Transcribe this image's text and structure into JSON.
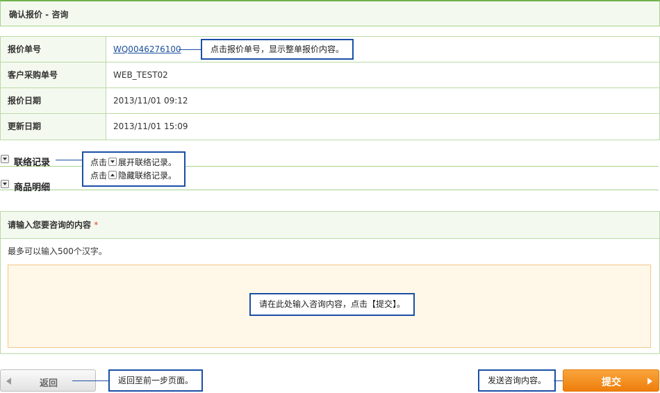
{
  "header": {
    "title": "确认报价 - 咨询"
  },
  "info": {
    "rows": [
      {
        "label": "报价单号",
        "value": "WQ0046276100"
      },
      {
        "label": "客户采购单号",
        "value": "WEB_TEST02"
      },
      {
        "label": "报价日期",
        "value": "2013/11/01 09:12"
      },
      {
        "label": "更新日期",
        "value": "2013/11/01 15:09"
      }
    ]
  },
  "sections": {
    "contact": "联络记录",
    "items": "商品明细"
  },
  "inquiry": {
    "title": "请输入您要咨询的内容",
    "required_mark": "*",
    "hint": "最多可以输入500个汉字。",
    "value": ""
  },
  "callouts": {
    "quote_no": "点击报价单号，显示整单报价内容。",
    "expand_prefix": "点击",
    "expand_suffix": "展开联络记录。",
    "collapse_prefix": "点击",
    "collapse_suffix": "隐藏联络记录。",
    "textarea": "请在此处输入咨询内容，点击【提交】。",
    "back": "返回至前一步页面。",
    "send": "发送咨询内容。"
  },
  "buttons": {
    "back": "返回",
    "submit": "提交"
  },
  "colors": {
    "accent_green": "#6fb24a",
    "callout_border": "#1a4ea6",
    "submit_orange": "#ee7e0c"
  }
}
